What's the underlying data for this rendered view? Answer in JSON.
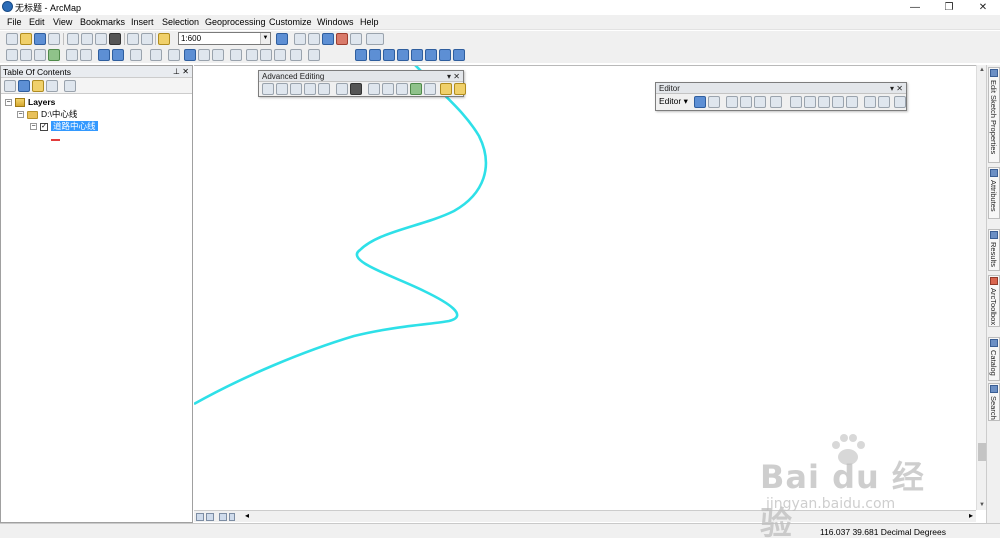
{
  "window": {
    "title": "无标题 - ArcMap",
    "buttons": {
      "minimize": "—",
      "restore": "❐",
      "close": "✕"
    }
  },
  "menu": [
    "File",
    "Edit",
    "View",
    "Bookmarks",
    "Insert",
    "Selection",
    "Geoprocessing",
    "Customize",
    "Windows",
    "Help"
  ],
  "standard_toolbar": {
    "scale": "1:600"
  },
  "toc": {
    "title": "Table Of Contents",
    "pin": "📌",
    "close": "✕",
    "root": "Layers",
    "folder": "D:\\中心线",
    "layer": "道路中心线",
    "layer_checked": true
  },
  "advanced_editing": {
    "title": "Advanced Editing"
  },
  "editor_toolbar": {
    "title": "Editor",
    "dropdown": "Editor ▾"
  },
  "dock_tabs": [
    "Edit Sketch Properties",
    "Attributes",
    "Results",
    "ArcToolbox",
    "Catalog",
    "Search"
  ],
  "status": {
    "coordinates": "116.037  39.681 Decimal Degrees"
  },
  "watermark": {
    "main": "Bai  du 经验",
    "sub": "jingyan.baidu.com"
  },
  "map": {
    "line_color": "#2ee0e8"
  }
}
